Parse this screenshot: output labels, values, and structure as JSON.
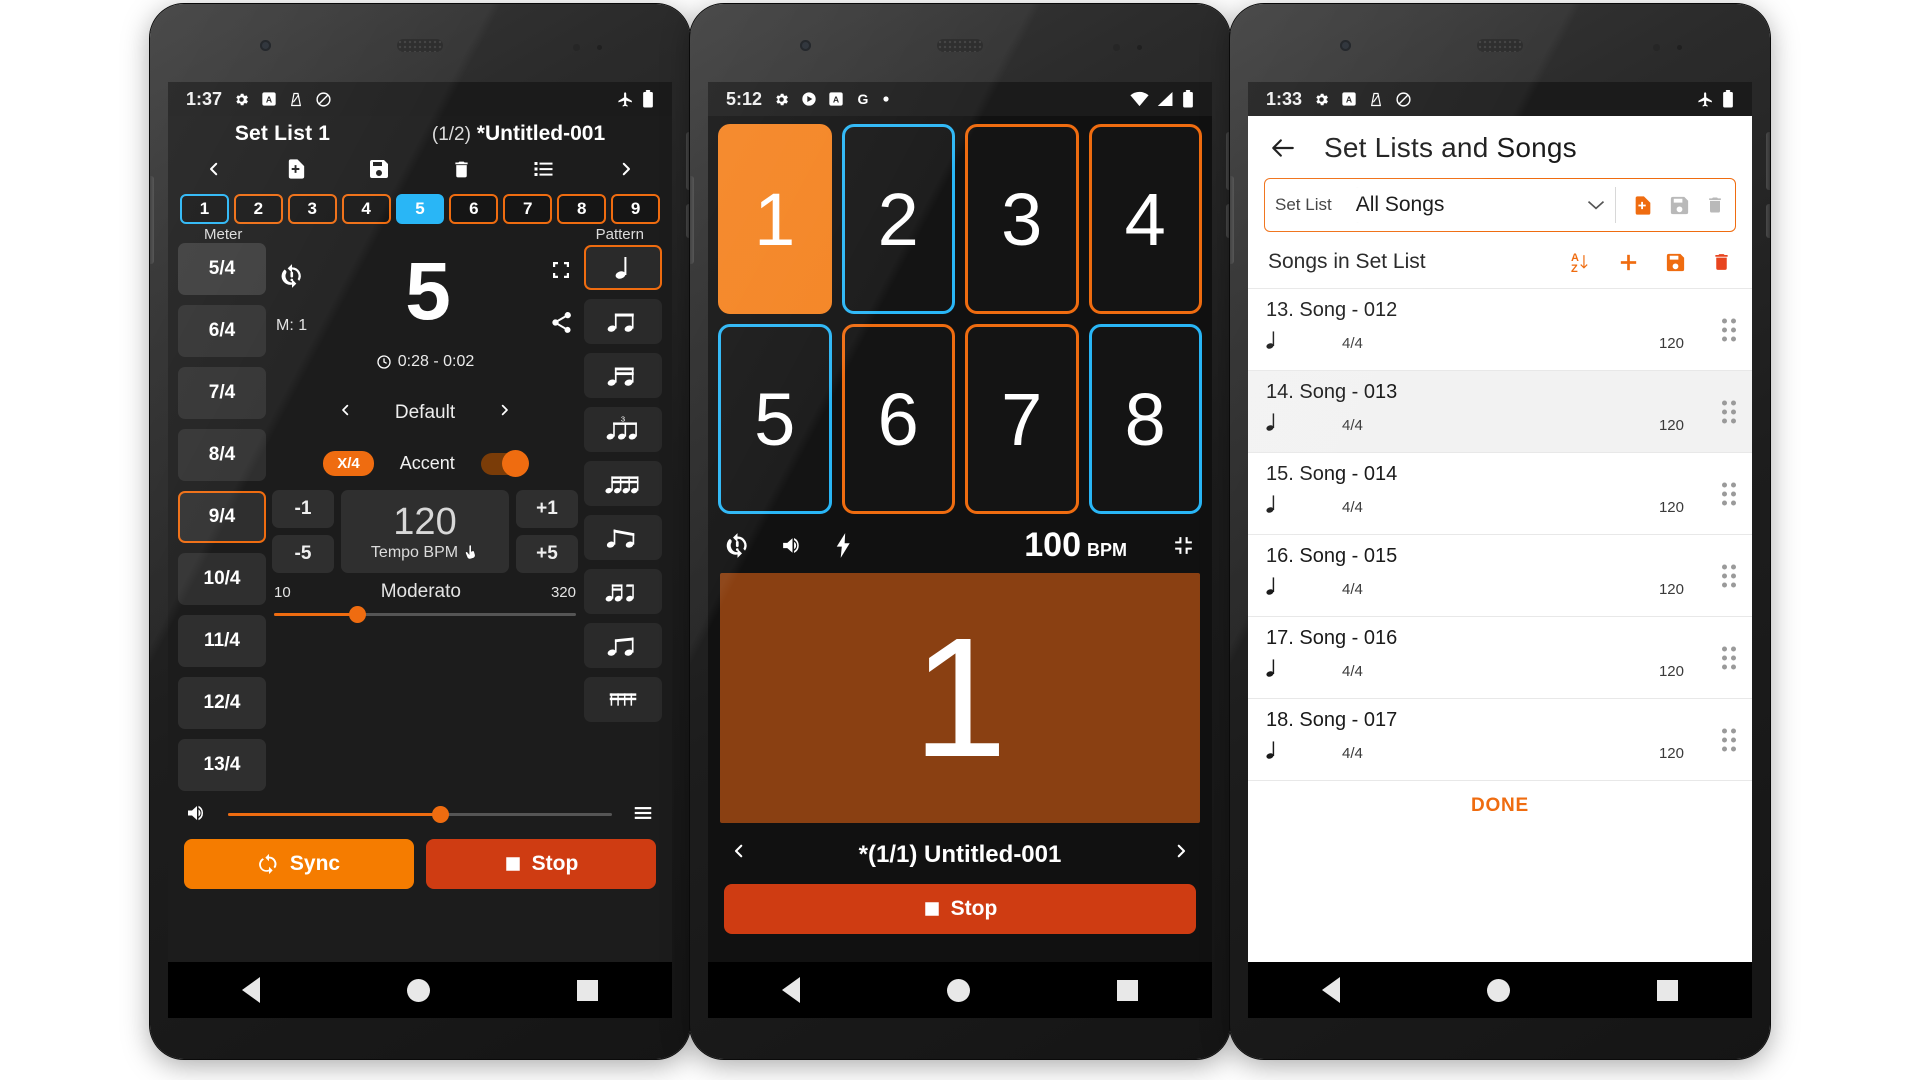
{
  "phone1": {
    "status": {
      "time": "1:37",
      "icons": [
        "gear-icon",
        "a-badge-icon",
        "metronome-icon",
        "do-not-disturb-icon",
        "airplane-icon",
        "battery-icon"
      ]
    },
    "header": {
      "set_list": "Set List 1",
      "song_page": "(1/2)",
      "song_title": "*Untitled-001"
    },
    "toolbar": [
      "prev-icon",
      "new-file-icon",
      "save-icon",
      "delete-icon",
      "list-icon",
      "next-icon"
    ],
    "beats": [
      "1",
      "2",
      "3",
      "4",
      "5",
      "6",
      "7",
      "8",
      "9"
    ],
    "current_beat_index": 4,
    "labels": {
      "meter": "Meter",
      "pattern": "Pattern"
    },
    "meters": [
      "5/4",
      "6/4",
      "7/4",
      "8/4",
      "9/4",
      "10/4",
      "11/4",
      "12/4",
      "13/4"
    ],
    "selected_meter": "9/4",
    "big_beat": "5",
    "measure_label": "M: 1",
    "time_display": "0:28 - 0:02",
    "preset": "Default",
    "subdivision_pill": "X/4",
    "accent_label": "Accent",
    "accent_on": true,
    "tempo": {
      "minus1": "-1",
      "minus5": "-5",
      "plus1": "+1",
      "plus5": "+5",
      "value": "120",
      "label": "Tempo BPM"
    },
    "tempo_slider": {
      "min": "10",
      "max": "320",
      "marking": "Moderato",
      "value": 120,
      "percent": 28
    },
    "volume_percent": 57,
    "buttons": {
      "sync": "Sync",
      "stop": "Stop"
    }
  },
  "phone2": {
    "status": {
      "time": "5:12",
      "icons": [
        "gear-icon",
        "play-badge-icon",
        "a-badge-icon",
        "google-icon",
        "dot-icon",
        "wifi-icon",
        "signal-icon",
        "battery-icon"
      ]
    },
    "beats": [
      {
        "label": "1",
        "accent": "orange",
        "active": true
      },
      {
        "label": "2",
        "accent": "blue",
        "active": false
      },
      {
        "label": "3",
        "accent": "orange",
        "active": false
      },
      {
        "label": "4",
        "accent": "orange",
        "active": false
      },
      {
        "label": "5",
        "accent": "blue",
        "active": false
      },
      {
        "label": "6",
        "accent": "orange",
        "active": false
      },
      {
        "label": "7",
        "accent": "orange",
        "active": false
      },
      {
        "label": "8",
        "accent": "blue",
        "active": false
      }
    ],
    "controls": [
      "loop-warning-icon",
      "volume-icon",
      "flash-icon",
      "fullscreen-exit-icon"
    ],
    "bpm": {
      "value": "100",
      "unit": "BPM"
    },
    "flash_beat": "1",
    "song_nav": {
      "prev": "prev-icon",
      "title": "*(1/1) Untitled-001",
      "next": "next-icon"
    },
    "stop_label": "Stop"
  },
  "phone3": {
    "status": {
      "time": "1:33",
      "icons": [
        "gear-icon",
        "a-badge-icon",
        "metronome-icon",
        "do-not-disturb-icon",
        "airplane-icon",
        "battery-icon"
      ]
    },
    "appbar": {
      "back": "back-arrow-icon",
      "title": "Set Lists and Songs"
    },
    "setlist_row": {
      "label": "Set List",
      "value": "All Songs",
      "actions": [
        "new-setlist-icon",
        "save-setlist-icon",
        "delete-setlist-icon"
      ]
    },
    "songs_header": {
      "title": "Songs in Set List",
      "actions": [
        "sort-az-icon",
        "add-song-icon",
        "save-songs-icon",
        "delete-songs-icon"
      ]
    },
    "songs": [
      {
        "name": "13. Song - 012",
        "note": "quarter-note",
        "signature": "4/4",
        "bpm": "120",
        "highlight": false
      },
      {
        "name": "14. Song - 013",
        "note": "quarter-note",
        "signature": "4/4",
        "bpm": "120",
        "highlight": true
      },
      {
        "name": "15. Song - 014",
        "note": "quarter-note",
        "signature": "4/4",
        "bpm": "120",
        "highlight": false
      },
      {
        "name": "16. Song - 015",
        "note": "quarter-note",
        "signature": "4/4",
        "bpm": "120",
        "highlight": false
      },
      {
        "name": "17. Song - 016",
        "note": "quarter-note",
        "signature": "4/4",
        "bpm": "120",
        "highlight": false
      },
      {
        "name": "18. Song - 017",
        "note": "quarter-note",
        "signature": "4/4",
        "bpm": "120",
        "highlight": false
      }
    ],
    "done_label": "DONE"
  },
  "colors": {
    "accent": "#ef6c10",
    "blue": "#29b6f6",
    "stop": "#cf3c12",
    "sync": "#f57c00",
    "flash": "#8a4012"
  }
}
